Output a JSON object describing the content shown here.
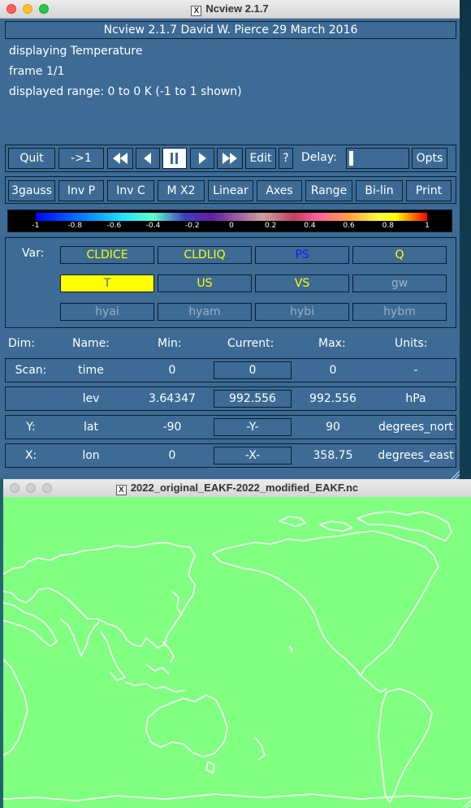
{
  "main_window": {
    "title": "Ncview 2.1.7",
    "header": "Ncview 2.1.7 David W. Pierce  29 March 2016",
    "info_lines": [
      "displaying Temperature",
      "frame 1/1",
      "displayed range: 0 to 0 K (-1 to 1 shown)"
    ],
    "controls": {
      "quit": "Quit",
      "goto_first": "->1",
      "edit": "Edit",
      "help": "?",
      "delay_label": "Delay:",
      "opts": "Opts"
    },
    "options": [
      "3gauss",
      "Inv P",
      "Inv C",
      "M X2",
      "Linear",
      "Axes",
      "Range",
      "Bi-lin",
      "Print"
    ],
    "colorbar_ticks": [
      "-1",
      "-0.8",
      "-0.6",
      "-0.4",
      "-0.2",
      "0",
      "0.2",
      "0.4",
      "0.6",
      "0.8",
      "1"
    ],
    "var_label": "Var:",
    "variables": [
      {
        "name": "CLDICE",
        "color": "#ffff00"
      },
      {
        "name": "CLDLIQ",
        "color": "#ffff00"
      },
      {
        "name": "PS",
        "color": "#1a1aff"
      },
      {
        "name": "Q",
        "color": "#ffff00"
      },
      {
        "name": "T",
        "color": "#3d6b95",
        "selected": true
      },
      {
        "name": "US",
        "color": "#ffff00"
      },
      {
        "name": "VS",
        "color": "#ffff00"
      },
      {
        "name": "gw",
        "color": "#9bb0c4"
      },
      {
        "name": "hyai",
        "color": "#9bb0c4"
      },
      {
        "name": "hyam",
        "color": "#9bb0c4"
      },
      {
        "name": "hybi",
        "color": "#9bb0c4"
      },
      {
        "name": "hybm",
        "color": "#9bb0c4"
      }
    ],
    "dim_headers": {
      "dim": "Dim:",
      "name": "Name:",
      "min": "Min:",
      "current": "Current:",
      "max": "Max:",
      "units": "Units:"
    },
    "dims": [
      {
        "dim": "Scan:",
        "name": "time",
        "min": "0",
        "current": "0",
        "max": "0",
        "units": "-"
      },
      {
        "dim": "",
        "name": "lev",
        "min": "3.64347",
        "current": "992.556",
        "max": "992.556",
        "units": "hPa"
      },
      {
        "dim": "Y:",
        "name": "lat",
        "min": "-90",
        "current": "-Y-",
        "max": "90",
        "units": "degrees_nort"
      },
      {
        "dim": "X:",
        "name": "lon",
        "min": "0",
        "current": "-X-",
        "max": "358.75",
        "units": "degrees_east"
      }
    ]
  },
  "map_window": {
    "title": "2022_original_EAKF-2022_modified_EAKF.nc",
    "background_color": "#80ff80",
    "coastline_color": "#ffffff"
  }
}
